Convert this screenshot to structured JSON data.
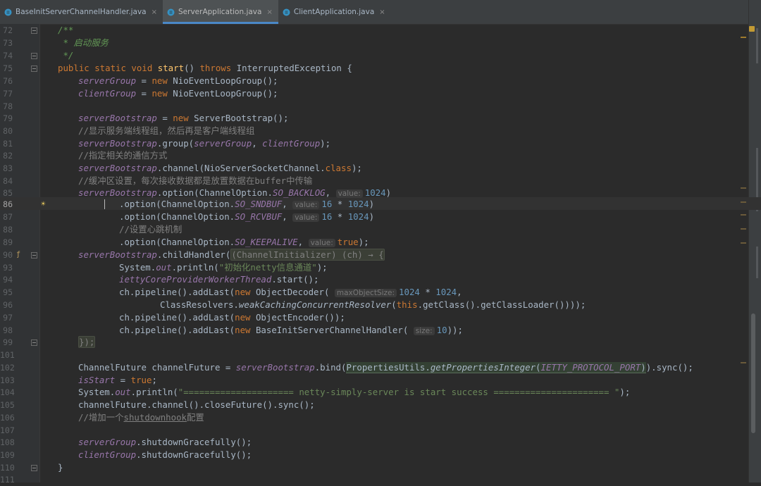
{
  "tabs": [
    {
      "label": "BaseInitServerChannelHandler.java",
      "close": "×",
      "active": false,
      "icon": "java-class-icon"
    },
    {
      "label": "ServerApplication.java",
      "close": "×",
      "active": true,
      "icon": "java-class-icon"
    },
    {
      "label": "ClientApplication.java",
      "close": "×",
      "active": false,
      "icon": "java-class-icon"
    }
  ],
  "lines": {
    "l72": {
      "n": "72",
      "a": "/**"
    },
    "l73": {
      "n": "73",
      "a": " * 启动服务"
    },
    "l74": {
      "n": "74",
      "a": " */"
    },
    "l75": {
      "n": "75",
      "a": "public static void ",
      "b": "start",
      "c": "() ",
      "d": "throws ",
      "e": "InterruptedException {"
    },
    "l76": {
      "n": "76",
      "a": "serverGroup",
      "b": " = ",
      "c": "new ",
      "d": "NioEventLoopGroup();"
    },
    "l77": {
      "n": "77",
      "a": "clientGroup",
      "b": " = ",
      "c": "new ",
      "d": "NioEventLoopGroup();"
    },
    "l78": {
      "n": "78"
    },
    "l79": {
      "n": "79",
      "a": "serverBootstrap",
      "b": " = ",
      "c": "new ",
      "d": "ServerBootstrap();"
    },
    "l80": {
      "n": "80",
      "a": "//显示服务端线程组，然后再是客户端线程组"
    },
    "l81": {
      "n": "81",
      "a": "serverBootstrap",
      "b": ".group(",
      "c": "serverGroup",
      "d": ", ",
      "e": "clientGroup",
      "f": ");"
    },
    "l82": {
      "n": "82",
      "a": "//指定相关的通信方式"
    },
    "l83": {
      "n": "83",
      "a": "serverBootstrap",
      "b": ".channel(NioServerSocketChannel.",
      "c": "class",
      "d": ");"
    },
    "l84": {
      "n": "84",
      "a": "//缓冲区设置，每次接收数据都是放置数据在buffer中传输"
    },
    "l85": {
      "n": "85",
      "a": "serverBootstrap",
      "b": ".option(ChannelOption.",
      "c": "SO_BACKLOG",
      "d": ", ",
      "h": "value:",
      "e": "1024",
      "f": ")"
    },
    "l86": {
      "n": "86",
      "b": ".option(ChannelOption.",
      "c": "SO_SNDBUF",
      "d": ", ",
      "h": "value:",
      "e": "16",
      "g": " * ",
      "i": "1024",
      "f": ")"
    },
    "l87": {
      "n": "87",
      "b": ".option(ChannelOption.",
      "c": "SO_RCVBUF",
      "d": ", ",
      "h": "value:",
      "e": "16",
      "g": " * ",
      "i": "1024",
      "f": ")"
    },
    "l88": {
      "n": "88",
      "a": "//设置心跳机制"
    },
    "l89": {
      "n": "89",
      "b": ".option(ChannelOption.",
      "c": "SO_KEEPALIVE",
      "d": ", ",
      "h": "value:",
      "e": "true",
      "f": ");"
    },
    "l90": {
      "n": "90",
      "a": "serverBootstrap",
      "b": ".childHandler(",
      "c": "(ChannelInitializer) (ch) → {"
    },
    "l93": {
      "n": "93",
      "a": "System.",
      "b": "out",
      "c": ".println(",
      "d": "\"初始化netty信息通道\"",
      "e": ");"
    },
    "l94": {
      "n": "94",
      "a": "iettyCoreProviderWorkerThread",
      "b": ".start();"
    },
    "l95": {
      "n": "95",
      "a": "ch.pipeline().addLast(",
      "b": "new ",
      "c": "ObjectDecoder( ",
      "h": "maxObjectSize:",
      "d": "1024",
      "g": " * ",
      "e": "1024",
      "f": ","
    },
    "l96": {
      "n": "96",
      "a": "ClassResolvers.",
      "b": "weakCachingConcurrentResolver",
      "c": "(",
      "d": "this",
      "e": ".getClass().getClassLoader())));"
    },
    "l97": {
      "n": "97",
      "a": "ch.pipeline().addLast(",
      "b": "new ",
      "c": "ObjectEncoder());"
    },
    "l98": {
      "n": "98",
      "a": "ch.pipeline().addLast(",
      "b": "new ",
      "c": "BaseInitServerChannelHandler( ",
      "h": "size:",
      "d": "10",
      "f": "));"
    },
    "l99": {
      "n": "99",
      "a": "});"
    },
    "l101": {
      "n": "101"
    },
    "l102": {
      "n": "102",
      "a": "ChannelFuture channelFuture = ",
      "b": "serverBootstrap",
      "c": ".bind(",
      "d": "PropertiesUtils.",
      "e": "getPropertiesInteger",
      "f": "(",
      "g": "IETTY_PROTOCOL_PORT",
      "i": ")",
      "j": ").sync();"
    },
    "l103": {
      "n": "103",
      "a": "isStart",
      "b": " = ",
      "c": "true",
      "d": ";"
    },
    "l104": {
      "n": "104",
      "a": "System.",
      "b": "out",
      "c": ".println(",
      "d": "\"===================== netty-simply-server is start success ====================== \"",
      "e": ");"
    },
    "l105": {
      "n": "105",
      "a": "channelFuture.channel().closeFuture().sync();"
    },
    "l106": {
      "n": "106",
      "a": "//增加一个",
      "b": "shutdownhook",
      "c": "配置"
    },
    "l107": {
      "n": "107"
    },
    "l108": {
      "n": "108",
      "a": "serverGroup",
      "b": ".shutdownGracefully();"
    },
    "l109": {
      "n": "109",
      "a": "clientGroup",
      "b": ".shutdownGracefully();"
    },
    "l110": {
      "n": "110",
      "a": "}"
    },
    "l111": {
      "n": "111"
    }
  },
  "colors": {
    "keyword": "#cc7832",
    "field": "#9876aa",
    "string": "#6a8759",
    "number": "#6897bb",
    "comment": "#808080",
    "method": "#ffc66d",
    "background": "#2b2b2b"
  }
}
